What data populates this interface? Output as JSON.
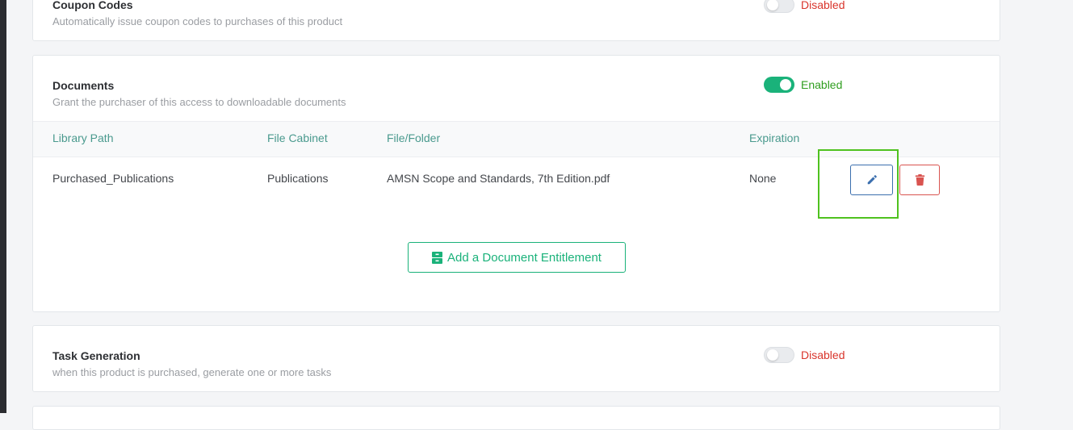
{
  "coupon": {
    "title": "Coupon Codes",
    "description": "Automatically issue coupon codes to purchases of this product",
    "status": "Disabled"
  },
  "documents": {
    "title": "Documents",
    "description": "Grant the purchaser of this access to downloadable documents",
    "status": "Enabled",
    "columns": [
      "Library Path",
      "File Cabinet",
      "File/Folder",
      "Expiration"
    ],
    "rows": [
      {
        "library_path": "Purchased_Publications",
        "file_cabinet": "Publications",
        "file_folder": "AMSN Scope and Standards, 7th Edition.pdf",
        "expiration": "None"
      }
    ],
    "add_button_label": "Add a Document Entitlement",
    "icons": {
      "edit": "pencil-icon",
      "delete": "trash-icon",
      "add": "file-cabinet-icon"
    }
  },
  "tasks": {
    "title": "Task Generation",
    "description": "when this product is purchased, generate one or more tasks",
    "status": "Disabled"
  },
  "colors": {
    "accent_green": "#1ab27a",
    "enabled_text": "#2f9e1f",
    "disabled_text": "#d9342b",
    "edit_blue": "#3b6fae",
    "delete_red": "#d9534f",
    "table_header_text": "#4a9a8e",
    "highlight": "#4fc21f"
  }
}
